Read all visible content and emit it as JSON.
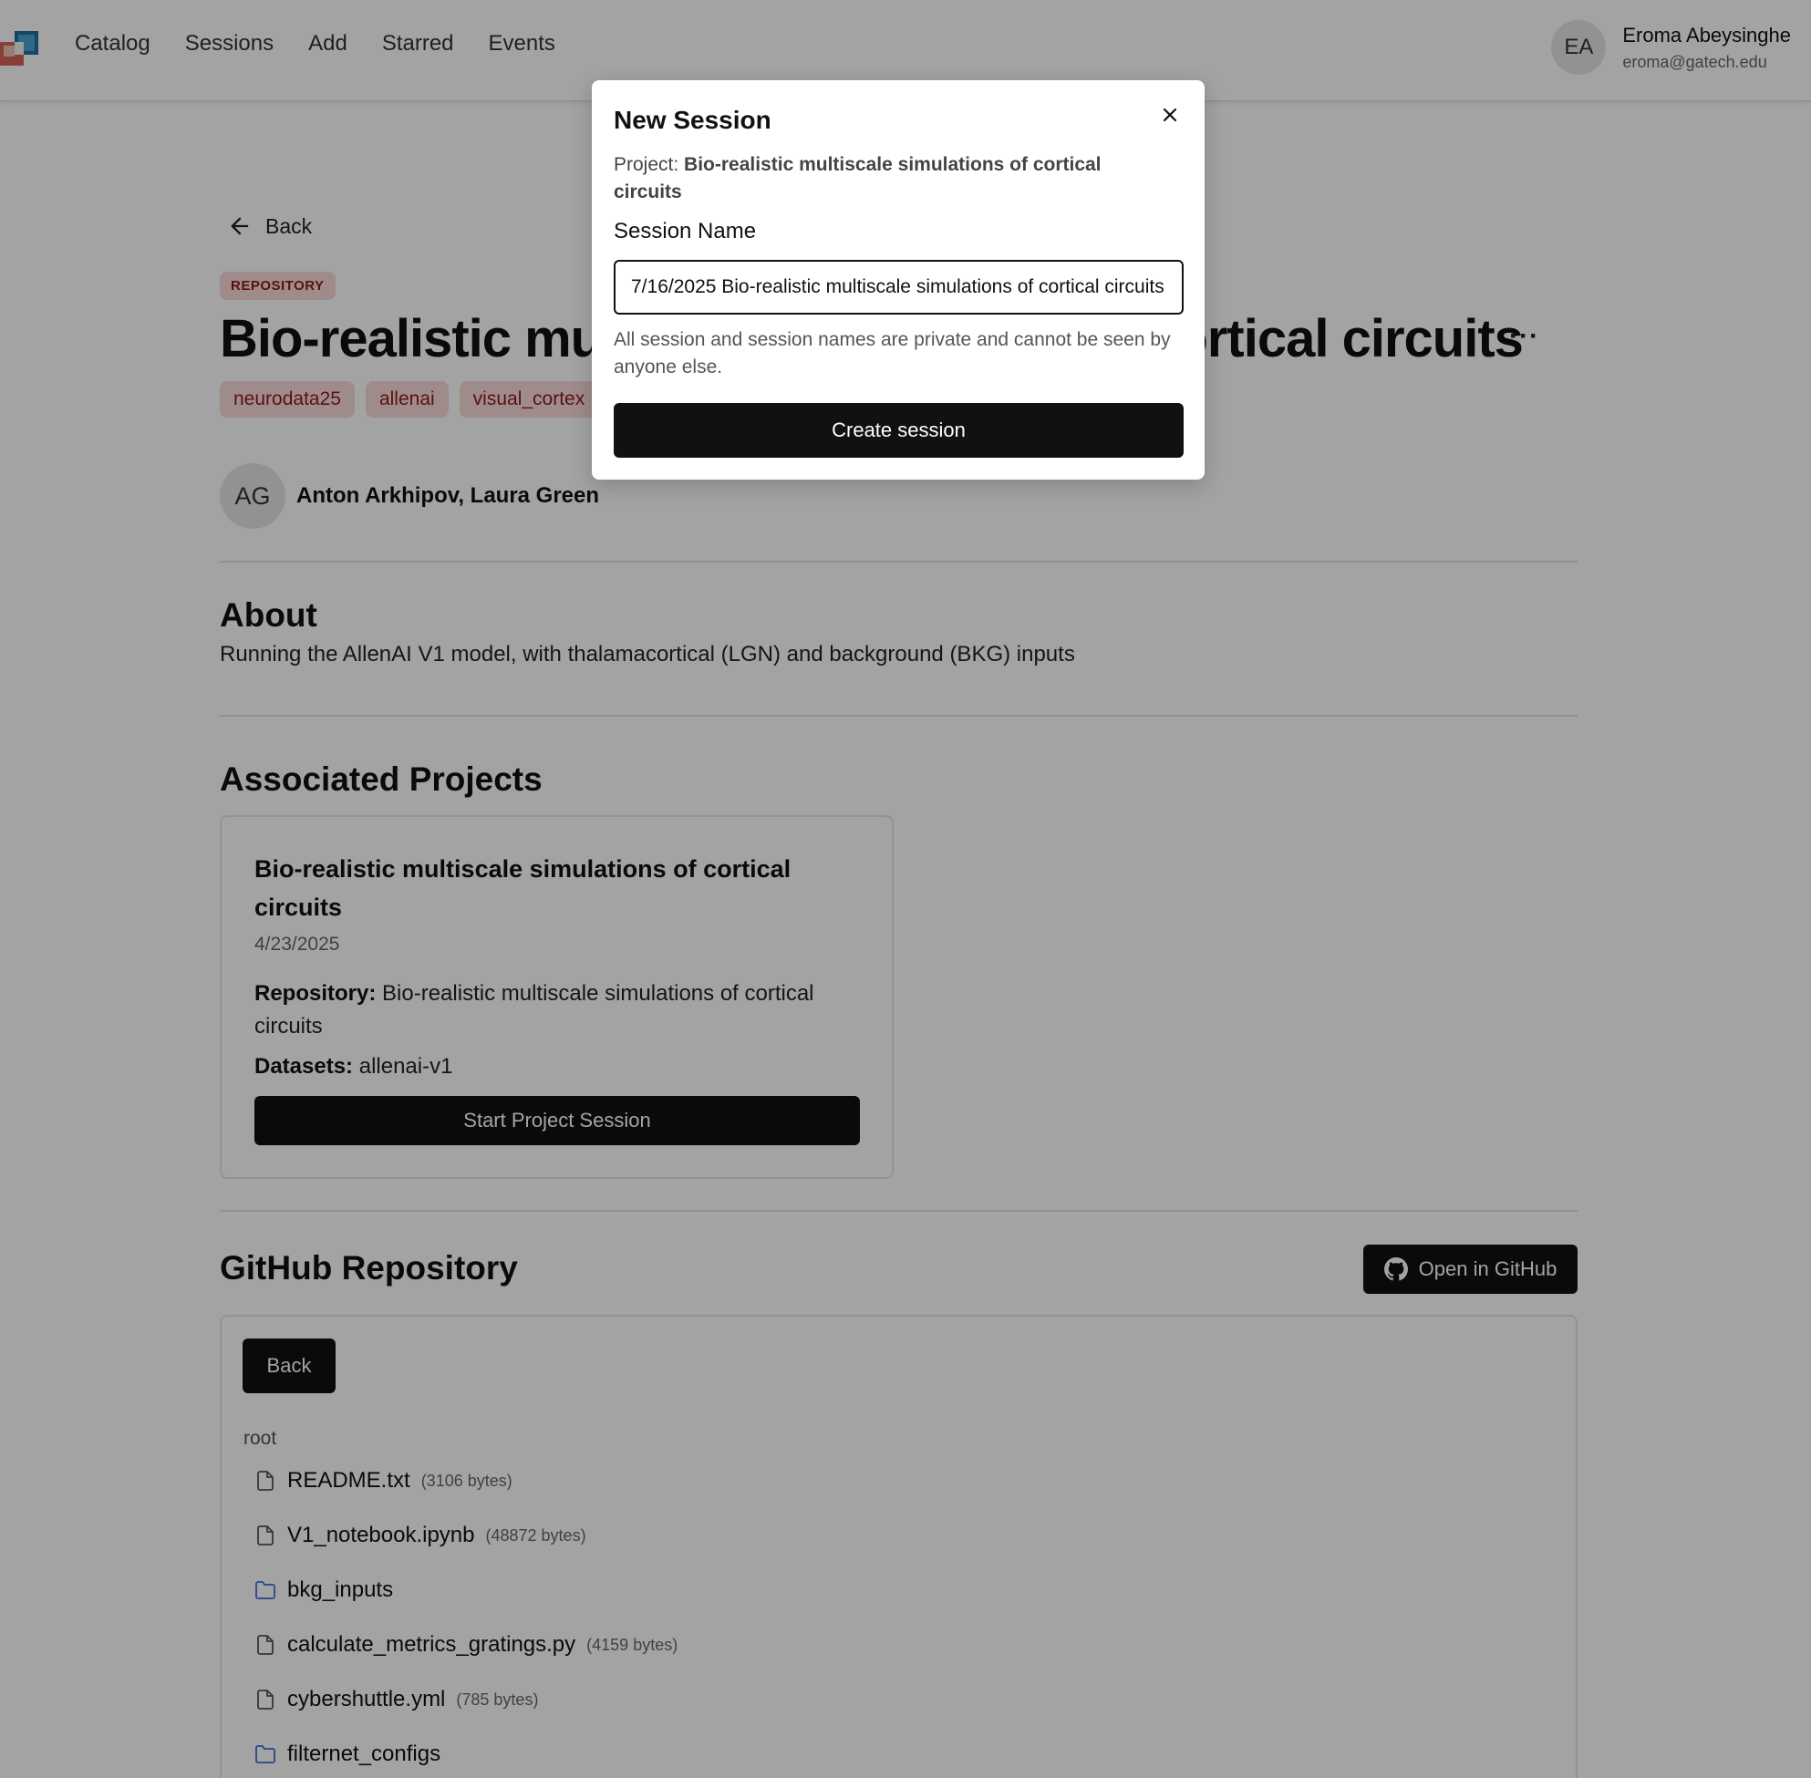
{
  "nav": {
    "links": [
      "Catalog",
      "Sessions",
      "Add",
      "Starred",
      "Events"
    ],
    "user": {
      "initials": "EA",
      "name": "Eroma Abeysinghe",
      "email": "eroma@gatech.edu"
    }
  },
  "page": {
    "back_label": "Back",
    "type_badge": "REPOSITORY",
    "title": "Bio-realistic multiscale simulations of cortical circuits",
    "more_label": "···",
    "tags": [
      "neurodata25",
      "allenai",
      "visual_cortex"
    ],
    "authors": {
      "initials": "AG",
      "names": "Anton Arkhipov, Laura Green"
    }
  },
  "about": {
    "heading": "About",
    "text": "Running the AllenAI V1 model, with thalamacortical (LGN) and background (BKG) inputs"
  },
  "projects": {
    "heading": "Associated Projects",
    "card": {
      "title": "Bio-realistic multiscale simulations of cortical circuits",
      "date": "4/23/2025",
      "repo_label": "Repository:",
      "repo_value": "Bio-realistic multiscale simulations of cortical circuits",
      "datasets_label": "Datasets:",
      "datasets_value": "allenai-v1",
      "button": "Start Project Session"
    }
  },
  "github": {
    "heading": "GitHub Repository",
    "open_button": "Open in GitHub",
    "back_button": "Back",
    "breadcrumb": "root",
    "files": [
      {
        "name": "README.txt",
        "size": "(3106 bytes)",
        "kind": "file"
      },
      {
        "name": "V1_notebook.ipynb",
        "size": "(48872 bytes)",
        "kind": "file"
      },
      {
        "name": "bkg_inputs",
        "size": "",
        "kind": "folder"
      },
      {
        "name": "calculate_metrics_gratings.py",
        "size": "(4159 bytes)",
        "kind": "file"
      },
      {
        "name": "cybershuttle.yml",
        "size": "(785 bytes)",
        "kind": "file"
      },
      {
        "name": "filternet_configs",
        "size": "",
        "kind": "folder"
      }
    ]
  },
  "modal": {
    "title": "New Session",
    "project_label": "Project:",
    "project_name": "Bio-realistic multiscale simulations of cortical circuits",
    "session_label": "Session Name",
    "session_value": "7/16/2025 Bio-realistic multiscale simulations of cortical circuits",
    "help_text": "All session and session names are private and cannot be seen by anyone else.",
    "create_button": "Create session"
  },
  "colors": {
    "tag_bg": "#fbdada",
    "tag_text": "#8b1a1a",
    "dark_button": "#111114",
    "folder_icon": "#3b6fd8",
    "overlay": "rgba(0,0,0,0.36)"
  }
}
